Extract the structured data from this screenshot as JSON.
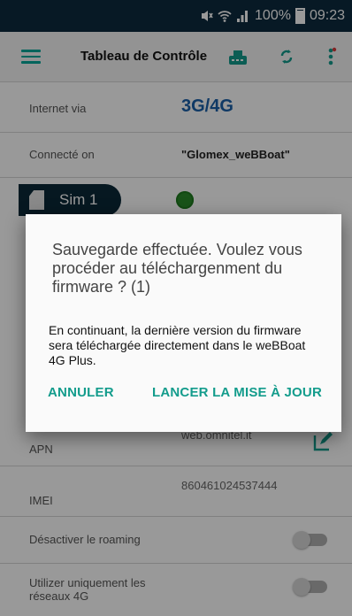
{
  "status_bar": {
    "battery": "100%",
    "time": "09:23"
  },
  "app_bar": {
    "title": "Tableau de Contrôle",
    "icons": [
      "menu-icon",
      "router-icon",
      "sync-icon",
      "more-vert-icon"
    ]
  },
  "rows": {
    "internet_via": {
      "label": "Internet via",
      "value": "3G/4G"
    },
    "connected_on": {
      "label": "Connecté on",
      "value": "\"Glomex_weBBoat\""
    },
    "sim": {
      "label": "Sim 1",
      "status_color": "#2b8a2b"
    },
    "apn": {
      "label": "APN",
      "value": "web.omnitel.it"
    },
    "imei": {
      "label": "IMEI",
      "value": "860461024537444"
    },
    "roaming": {
      "label": "Désactiver le roaming",
      "checked": false
    },
    "only4g": {
      "label": "Utilizer uniquement les réseaux 4G",
      "checked": false
    }
  },
  "dialog": {
    "title": "Sauvegarde effectuée. Voulez vous procéder au téléchargenment du firmware ? (1)",
    "message": "En continuant, la dernière version du firmware sera téléchargée directement dans le weBBoat 4G Plus.",
    "cancel_label": "ANNULER",
    "confirm_label": "LANCER LA MISE À JOUR"
  },
  "colors": {
    "accent": "#139c8c",
    "status_bar": "#0c2b3e",
    "sim_pill": "#0a2838",
    "value_blue": "#1a5fa8"
  }
}
